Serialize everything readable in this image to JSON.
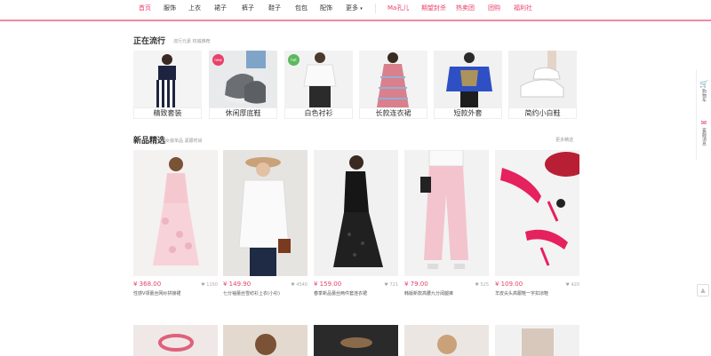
{
  "nav": {
    "items": [
      "首页",
      "服饰",
      "上衣",
      "裙子",
      "裤子",
      "鞋子",
      "包包",
      "配饰",
      "更多"
    ],
    "more_arrow": "▾",
    "promo": [
      "Ma孔儿",
      "期望封杀",
      "热卖团",
      "团购",
      "福利社"
    ]
  },
  "trending": {
    "title": "正在流行",
    "subtitle": "流行元素 权威推荐",
    "categories": [
      "精致套装",
      "休闲厚底鞋",
      "白色衬衫",
      "长款连衣裙",
      "短款外套",
      "简约小白鞋"
    ],
    "badges": [
      "new",
      "hot"
    ]
  },
  "newarrivals": {
    "title": "新品精选",
    "subtitle": "女装单品 紧跟时尚",
    "more": "更多精选",
    "products": [
      {
        "price": "¥ 368.00",
        "likes": "1150",
        "name": "性感V领蕾丝网纱拼接裙"
      },
      {
        "price": "¥ 149.90",
        "likes": "4540",
        "name": "七分袖蕾丝雪纺衫上衣(小衫)"
      },
      {
        "price": "¥ 159.00",
        "likes": "721",
        "name": "春季新品蕾丝两件套连衣裙"
      },
      {
        "price": "¥ 79.00",
        "likes": "525",
        "name": "韩版新款高腰九分阔腿裤"
      },
      {
        "price": "¥ 109.00",
        "likes": "420",
        "name": "羊皮尖头高跟鞋一字扣凉鞋"
      }
    ]
  },
  "rail": [
    {
      "icon": "🛒",
      "label": "购物车"
    },
    {
      "icon": "✉",
      "label": "客服消息"
    }
  ],
  "totop": "▲",
  "colors": {
    "accent": "#e8416a",
    "nav_border": "#f08aa5"
  }
}
